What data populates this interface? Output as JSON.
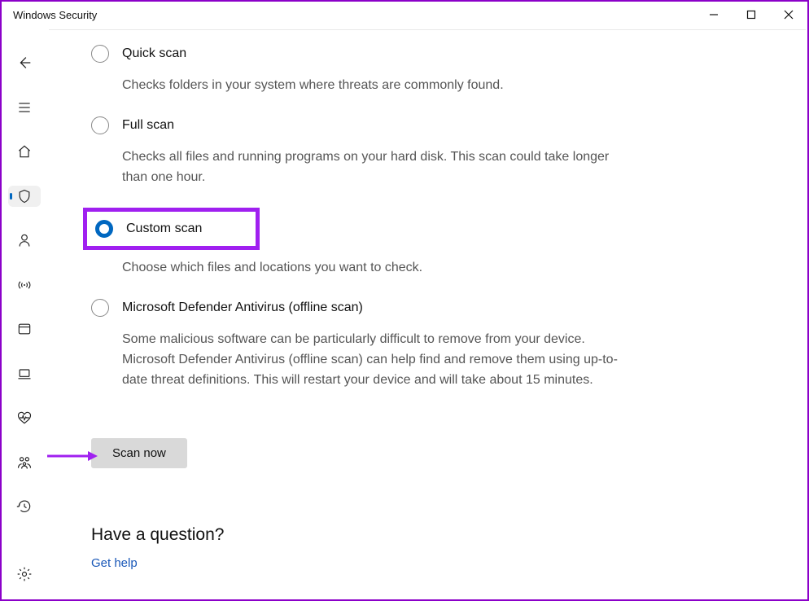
{
  "window": {
    "title": "Windows Security"
  },
  "sidebar": {
    "items": [
      {
        "name": "back"
      },
      {
        "name": "menu"
      },
      {
        "name": "home"
      },
      {
        "name": "virus-protection",
        "active": true
      },
      {
        "name": "account-protection"
      },
      {
        "name": "firewall-network"
      },
      {
        "name": "app-browser-control"
      },
      {
        "name": "device-security"
      },
      {
        "name": "device-performance"
      },
      {
        "name": "family-options"
      },
      {
        "name": "protection-history"
      }
    ],
    "settings": "settings"
  },
  "scan_options": {
    "quick": {
      "label": "Quick scan",
      "desc": "Checks folders in your system where threats are commonly found."
    },
    "full": {
      "label": "Full scan",
      "desc": "Checks all files and running programs on your hard disk. This scan could take longer than one hour."
    },
    "custom": {
      "label": "Custom scan",
      "desc": "Choose which files and locations you want to check.",
      "selected": true
    },
    "offline": {
      "label": "Microsoft Defender Antivirus (offline scan)",
      "desc": "Some malicious software can be particularly difficult to remove from your device. Microsoft Defender Antivirus (offline scan) can help find and remove them using up-to-date threat definitions. This will restart your device and will take about 15 minutes."
    }
  },
  "buttons": {
    "scan_now": "Scan now"
  },
  "help": {
    "title": "Have a question?",
    "link": "Get help"
  }
}
